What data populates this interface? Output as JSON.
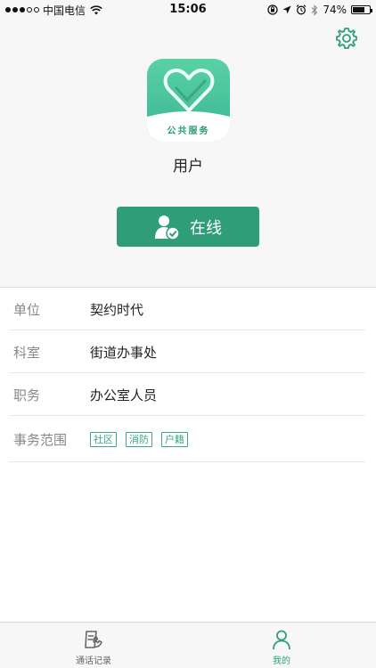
{
  "status_bar": {
    "carrier": "中国电信",
    "time": "15:06",
    "battery": "74%",
    "battery_level": 0.74,
    "icons": [
      "signal-dots-icon",
      "wifi-icon",
      "orientation-lock-icon",
      "location-arrow-icon",
      "alarm-icon",
      "bluetooth-icon",
      "battery-icon"
    ]
  },
  "header": {
    "settings_icon": "gear-icon",
    "logo_text": "公共服务",
    "user_name": "用户",
    "status_button_label": "在线",
    "status_icon": "user-check-icon"
  },
  "info": {
    "rows": [
      {
        "label": "单位",
        "value": "契约时代"
      },
      {
        "label": "科室",
        "value": "街道办事处"
      },
      {
        "label": "职务",
        "value": "办公室人员"
      }
    ],
    "scope": {
      "label": "事务范围",
      "tags": [
        "社区",
        "消防",
        "户籍"
      ]
    }
  },
  "tabbar": {
    "tabs": [
      {
        "label": "通话记录",
        "icon": "call-log-icon",
        "active": false
      },
      {
        "label": "我的",
        "icon": "user-icon",
        "active": true
      }
    ]
  },
  "colors": {
    "accent": "#2f9e78",
    "accent_light": "#3aa883",
    "inactive": "#666666"
  }
}
